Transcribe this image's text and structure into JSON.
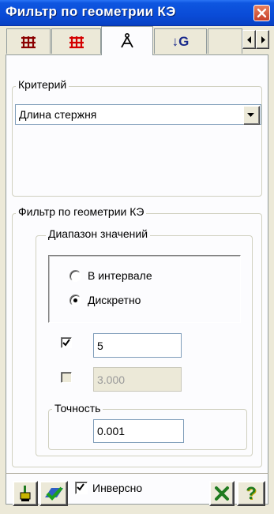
{
  "window": {
    "title": "Фильтр по геометрии КЭ",
    "close_icon": "close-icon"
  },
  "tabs": [
    {
      "icon": "grid-icon",
      "color": "#8b0000",
      "state": "inactive"
    },
    {
      "icon": "element-grid-icon",
      "color": "#d40000",
      "state": "inactive"
    },
    {
      "icon": "compass-icon",
      "color": "#000000",
      "state": "active"
    },
    {
      "icon": "arrow-g-icon",
      "color": "#1a2a8c",
      "text": "↓G",
      "state": "inactive"
    },
    {
      "icon": "scroll-arrows-icon",
      "state": "inactive"
    }
  ],
  "criterion": {
    "legend": "Критерий",
    "selected": "Длина стержня"
  },
  "filter": {
    "legend": "Фильтр по геометрии КЭ",
    "range": {
      "legend": "Диапазон значений",
      "options": [
        "В интервале",
        "Дискретно"
      ],
      "selected_option": "Дискретно",
      "value1": {
        "checked": true,
        "value": "5"
      },
      "value2": {
        "checked": false,
        "enabled": false,
        "value": "3.000"
      }
    },
    "precision": {
      "legend": "Точность",
      "value": "0.001"
    }
  },
  "bottom": {
    "invert_label": "Инверсно",
    "invert_checked": true,
    "help_label": "?",
    "colors": {
      "green": "#1f7a1f",
      "yellow": "#b8a400"
    }
  }
}
